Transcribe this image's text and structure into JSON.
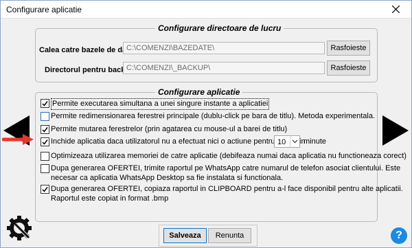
{
  "window": {
    "title": "Configurare aplicatie"
  },
  "dirs_group": {
    "legend": "Configurare directoare de lucru",
    "db_path": {
      "label": "Calea catre bazele de date:",
      "value": "C:\\COMENZI\\BAZEDATE\\",
      "button": "Rasfoieste"
    },
    "backup_path": {
      "label": "Directorul pentru backup:",
      "value": "C:\\COMENZI\\_BACKUP\\",
      "button": "Rasfoieste"
    }
  },
  "app_group": {
    "legend": "Configurare aplicatie",
    "options": [
      {
        "text": "Permite executarea simultana a unei singure instante a aplicatiei",
        "checked": true
      },
      {
        "text": "Permite redimensionarea ferestrei principale (dublu-click pe bara de titlu). Metoda experimentala.",
        "checked": false
      },
      {
        "text": "Permite mutarea ferestrelor (prin agatarea cu mouse-ul a barei de titlu)",
        "checked": true
      },
      {
        "text": "Inchide aplicatia daca utilizatorul nu a efectuat nici o actiune pentru cel putin",
        "checked": true,
        "select_value": "10",
        "suffix": "minute"
      },
      {
        "text": "Optimizeaza utilizarea memoriei de catre aplicatie (debifeaza numai daca aplicatia nu functioneaza corect)",
        "checked": false
      },
      {
        "text": "Dupa generarea OFERTEI, trimite raportul pe WhatsApp catre numarul de telefon asociat clientului.  Este",
        "text2": "necesar ca aplicatia WhatsApp Desktop sa fie instalata si functionala.",
        "checked": false
      },
      {
        "text": "Dupa generarea OFERTEI, copiaza raportul in CLIPBOARD pentru a-l face disponibil pentru alte aplicatii.",
        "text2": "Raportul este copiat in format .bmp",
        "checked": true
      }
    ]
  },
  "footer": {
    "save": "Salveaza",
    "cancel": "Renunta",
    "help": "?"
  },
  "icons": {
    "close": "close-icon",
    "prev": "arrow-left-icon",
    "next": "arrow-right-icon",
    "settings": "gear-wrench-icon",
    "help": "help-icon",
    "pointer": "red-arrow-icon"
  },
  "colors": {
    "accent_arrow": "#e8362b",
    "help": "#1a8be0"
  }
}
